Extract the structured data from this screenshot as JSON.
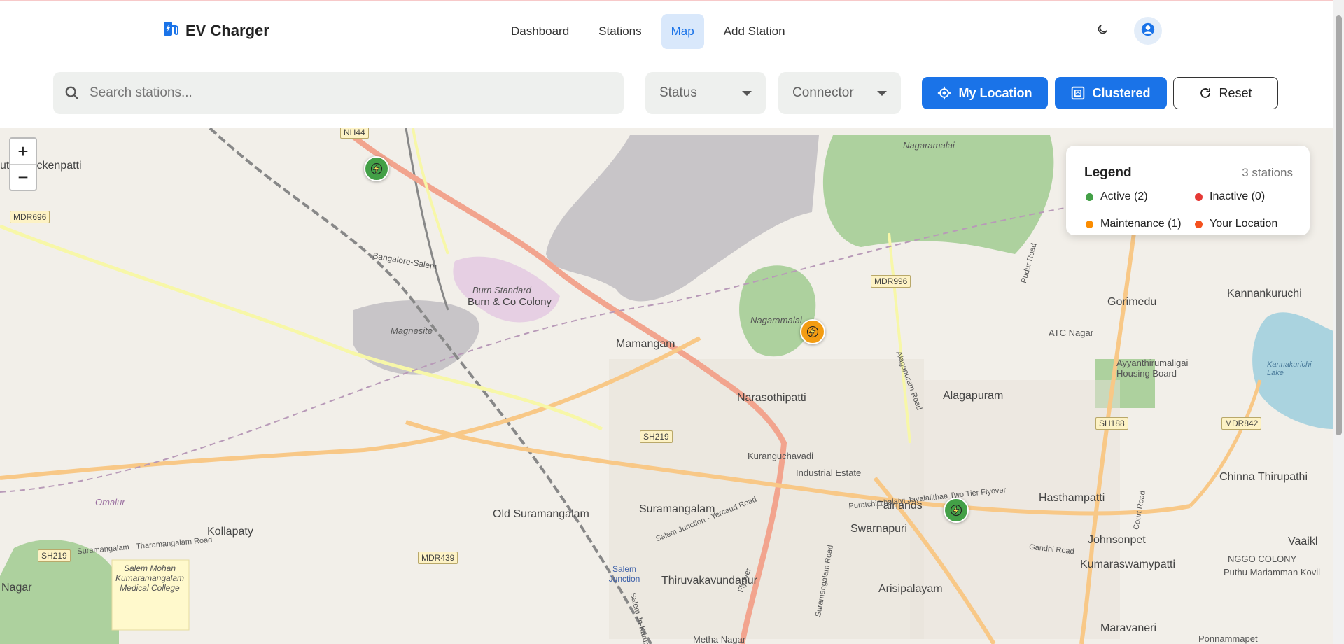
{
  "app": {
    "title": "EV Charger"
  },
  "nav": {
    "items": [
      "Dashboard",
      "Stations",
      "Map",
      "Add Station"
    ],
    "active": "Map"
  },
  "toolbar": {
    "search_placeholder": "Search stations...",
    "status_select": "Status",
    "connector_select": "Connector",
    "my_location": "My Location",
    "clustered": "Clustered",
    "reset": "Reset"
  },
  "zoom": {
    "in": "+",
    "out": "−"
  },
  "legend": {
    "title": "Legend",
    "count": "3 stations",
    "items": [
      {
        "label": "Active (2)",
        "color": "#43a047"
      },
      {
        "label": "Inactive (0)",
        "color": "#e53935"
      },
      {
        "label": "Maintenance (1)",
        "color": "#fb8c00"
      },
      {
        "label": "Your Location",
        "color": "#f4511e"
      }
    ]
  },
  "colors": {
    "accent": "#1a73e8",
    "active": "#43a047",
    "maintenance": "#f39c12"
  },
  "map_labels": {
    "places": [
      "Mamangam",
      "Narasothipatti",
      "Alagapuram",
      "Gorimedu",
      "Kannankuruchi",
      "ATC Nagar",
      "Old Suramangalam",
      "Suramangalam",
      "Swarnapuri",
      "Fairlands",
      "Hasthampatti",
      "Chinna Thirupathi",
      "Johnsonpet",
      "Kumaraswamypatti",
      "Thiruvakavundanur",
      "Arisipalayam",
      "Kollapaty",
      "Nagar",
      "uthunaickenpatti",
      "Maravaneri",
      "Metha Nagar",
      "Kuranguchavadi",
      "Industrial Estate",
      "NGGO COLONY",
      "Puthu Mariamman Kovil",
      "Ponnammapet",
      "Vaaikl"
    ],
    "features": [
      "Nagaramalai",
      "Burn Standard",
      "Burn & Co Colony",
      "Magnesite",
      "Salem Mohan Kumaramangalam Medical College",
      "Ayyanthirumaligai Housing Board",
      "Kannakurichi Lake",
      "Salem Junction",
      "Omalur"
    ],
    "roads": [
      "NH44",
      "MDR696",
      "MDR996",
      "SH219",
      "MDR439",
      "SH188",
      "MDR842",
      "Puratchi Thalaivi Jayalalithaa Two Tier Flyover",
      "Salem Junction - Yercaud Road",
      "Suramangalam - Tharamangalam Road",
      "Bangalore-Salem",
      "Alagapuram Road",
      "Gandhi Road",
      "Court Road",
      "Pudur Road",
      "Flyover",
      "Suramangalam Road",
      "Salem Jn-Karur"
    ]
  }
}
